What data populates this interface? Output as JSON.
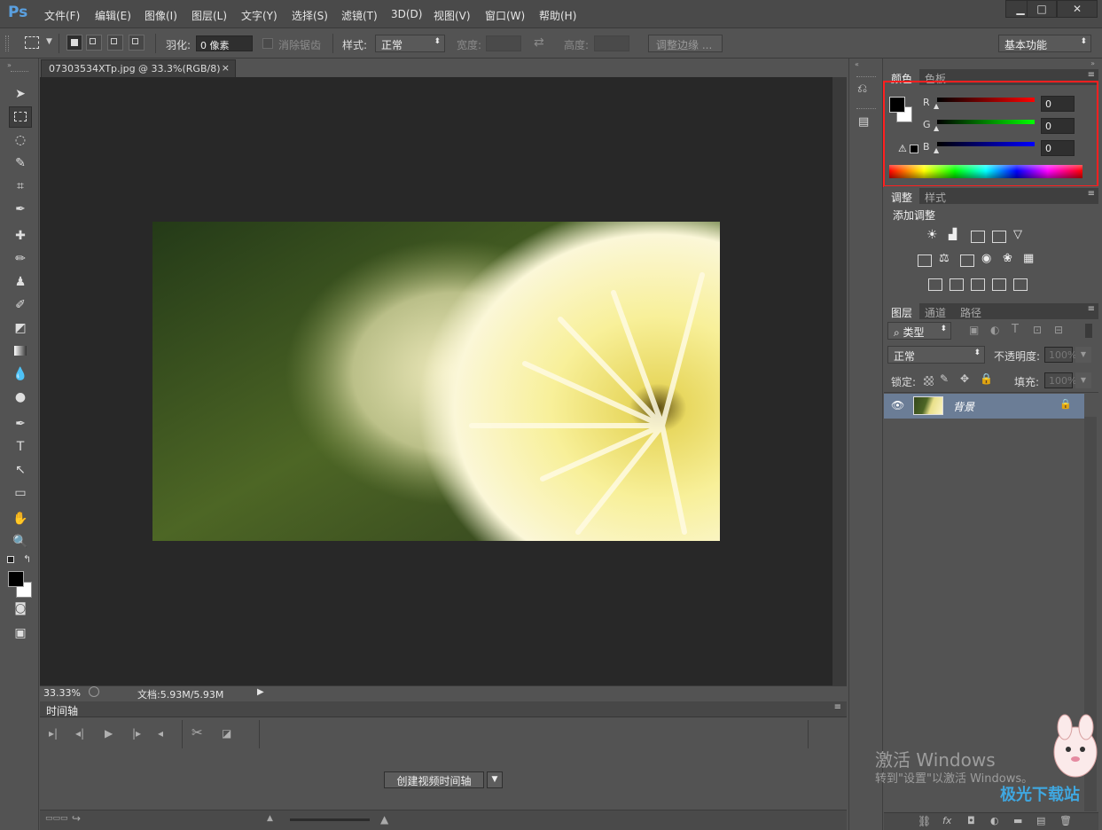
{
  "app": {
    "logo": "Ps"
  },
  "menu": [
    "文件(F)",
    "编辑(E)",
    "图像(I)",
    "图层(L)",
    "文字(Y)",
    "选择(S)",
    "滤镜(T)",
    "3D(D)",
    "视图(V)",
    "窗口(W)",
    "帮助(H)"
  ],
  "window_buttons": {
    "minimize": "▁",
    "maximize": "□",
    "close": "✕"
  },
  "options": {
    "feather_label": "羽化:",
    "feather_value": "0 像素",
    "antialias_label": "消除锯齿",
    "style_label": "样式:",
    "style_value": "正常",
    "width_label": "宽度:",
    "height_label": "高度:",
    "refine_button": "调整边缘 ...",
    "workspace": "基本功能"
  },
  "document": {
    "tab_title": "07303534XTp.jpg @ 33.3%(RGB/8)",
    "tab_close": "×",
    "zoom": "33.33%",
    "doc_info": "文档:5.93M/5.93M"
  },
  "timeline": {
    "title": "时间轴",
    "create_button": "创建视频时间轴"
  },
  "color_panel": {
    "tabs": [
      "颜色",
      "色板"
    ],
    "labels": [
      "R",
      "G",
      "B"
    ],
    "values": [
      "0",
      "0",
      "0"
    ]
  },
  "adjust_panel": {
    "tabs": [
      "调整",
      "样式"
    ],
    "title": "添加调整"
  },
  "layers_panel": {
    "tabs": [
      "图层",
      "通道",
      "路径"
    ],
    "filter": "类型",
    "blend": "正常",
    "opacity_label": "不透明度:",
    "opacity_value": "100%",
    "lock_label": "锁定:",
    "fill_label": "填充:",
    "fill_value": "100%",
    "layer_name": "背景"
  },
  "watermark": {
    "line1": "激活 Windows",
    "line2": "转到\"设置\"以激活 Windows。",
    "brand": "极光下载站"
  }
}
